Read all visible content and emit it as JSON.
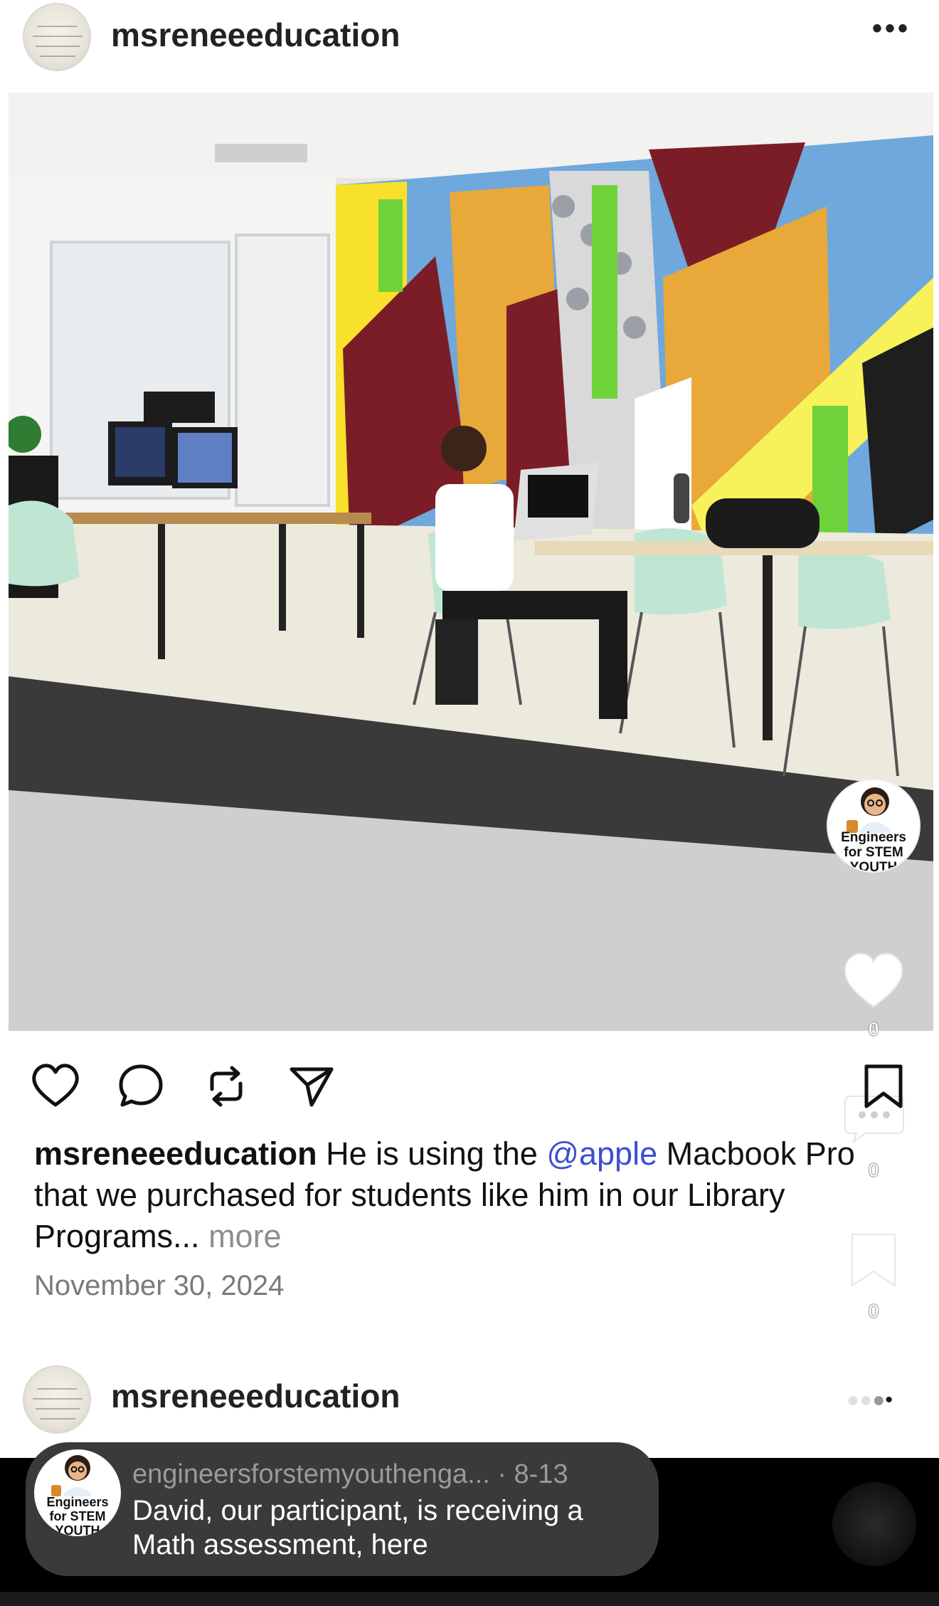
{
  "post": {
    "username": "msreneeeducation",
    "more_icon": "ellipsis-icon",
    "caption": {
      "username": "msreneeeducation",
      "text_before": " He is using the ",
      "mention": "@apple",
      "text_after": " Macbook Pro that we purchased for students like him in our Library Programs... ",
      "more": "more"
    },
    "date": "November 30, 2024",
    "actions": [
      "heart-icon",
      "comment-icon",
      "repost-icon",
      "share-icon",
      "bookmark-icon"
    ]
  },
  "overlay": {
    "avatar_line1": "Engineers",
    "avatar_line2": "for STEM",
    "avatar_line3": "YOUTH",
    "like_count": "0",
    "comment_count": "0",
    "save_count": "0"
  },
  "next_post": {
    "username": "msreneeeducation"
  },
  "reply": {
    "avatar_line1": "Engineers",
    "avatar_line2": "for STEM",
    "avatar_line3": "YOUTH",
    "meta": "engineersforstemyouthenga... · 8-13",
    "text": "David, our participant, is receiving a Math assessment, here"
  },
  "colors": {
    "mention": "#3b4fd0",
    "muted": "#8e8e8e",
    "bottom_bar": "#000000",
    "pill": "#3a3a3a"
  }
}
